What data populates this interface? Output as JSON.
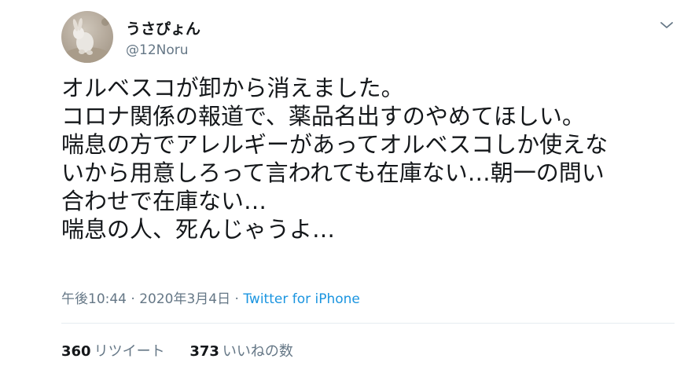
{
  "user": {
    "display_name": "うさぴょん",
    "handle": "@12Noru",
    "avatar_icon": "rabbit-avatar-icon"
  },
  "tweet": {
    "lines": [
      "オルベスコが卸から消えました。",
      "コロナ関係の報道で、薬品名出すのやめてほしい。",
      "喘息の方でアレルギーがあってオルベスコしか使えな",
      "いから用意しろって言われても在庫ない…朝一の問い",
      "合わせで在庫ない…",
      "喘息の人、死んじゃうよ…"
    ]
  },
  "meta": {
    "time": "午後10:44",
    "separator": " · ",
    "date": "2020年3月4日",
    "source": "Twitter for iPhone"
  },
  "stats": {
    "retweets_count": "360",
    "retweets_label": "リツイート",
    "likes_count": "373",
    "likes_label": "いいねの数"
  },
  "colors": {
    "text_primary": "#14171a",
    "text_secondary": "#657786",
    "link": "#1b95e0",
    "divider": "#e6ecf0"
  },
  "icons": {
    "more_menu": "chevron-down-icon"
  }
}
